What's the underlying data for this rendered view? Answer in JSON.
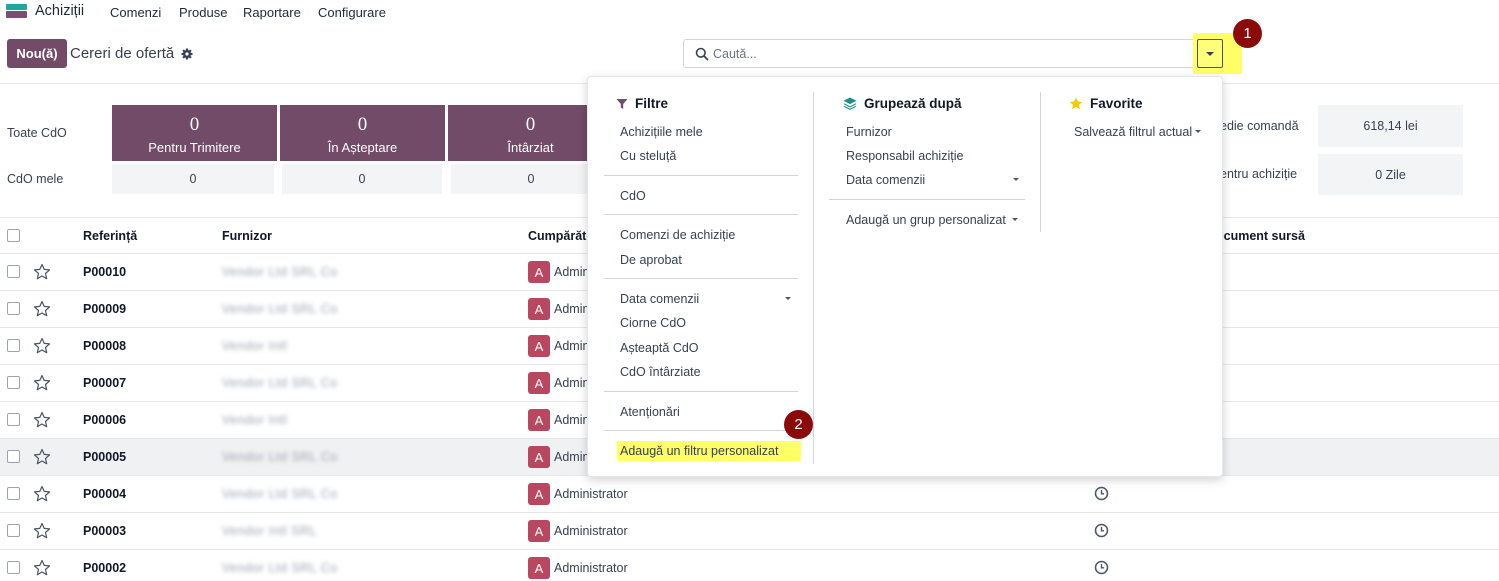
{
  "nav": {
    "app_name": "Achiziții",
    "menu": [
      "Comenzi",
      "Produse",
      "Raportare",
      "Configurare"
    ]
  },
  "control": {
    "new_button": "Nou(ă)",
    "title": "Cereri de ofertă",
    "search_placeholder": "Caută...",
    "badge1": "1",
    "badge2": "2"
  },
  "dashboard": {
    "row_labels": [
      "Toate CdO",
      "CdO mele"
    ],
    "tiles": [
      {
        "value": "0",
        "label": "Pentru Trimitere",
        "mine": "0"
      },
      {
        "value": "0",
        "label": "În Așteptare",
        "mine": "0"
      },
      {
        "value": "0",
        "label": "Întârziat",
        "mine": "0"
      }
    ],
    "right": [
      {
        "label": "edie comandă",
        "value": "618,14 lei"
      },
      {
        "label": "entru achiziție",
        "value": "0 Zile"
      }
    ]
  },
  "table": {
    "headers": {
      "reference": "Referință",
      "vendor": "Furnizor",
      "buyer": "Cumpărăto",
      "source": "ocument sursă"
    },
    "rows": [
      {
        "ref": "P00010",
        "vendor": "Vendor Ltd SRL Co",
        "avatar": "A",
        "buyer": "Admin"
      },
      {
        "ref": "P00009",
        "vendor": "Vendor Ltd SRL Co",
        "avatar": "A",
        "buyer": "Admin"
      },
      {
        "ref": "P00008",
        "vendor": "Vendor Intl",
        "avatar": "A",
        "buyer": "Admin"
      },
      {
        "ref": "P00007",
        "vendor": "Vendor Ltd SRL Co",
        "avatar": "A",
        "buyer": "Admin"
      },
      {
        "ref": "P00006",
        "vendor": "Vendor Intl",
        "avatar": "A",
        "buyer": "Admin"
      },
      {
        "ref": "P00005",
        "vendor": "Vendor Ltd SRL Co",
        "avatar": "A",
        "buyer": "Admin"
      },
      {
        "ref": "P00004",
        "vendor": "Vendor Ltd SRL Co",
        "avatar": "A",
        "buyer": "Administrator"
      },
      {
        "ref": "P00003",
        "vendor": "Vendor Intl SRL",
        "avatar": "A",
        "buyer": "Administrator"
      },
      {
        "ref": "P00002",
        "vendor": "Vendor Ltd SRL Co",
        "avatar": "A",
        "buyer": "Administrator"
      }
    ]
  },
  "dropdown": {
    "filters": {
      "title": "Filtre",
      "group1": [
        "Achizițiile mele",
        "Cu steluță"
      ],
      "group2": [
        "CdO"
      ],
      "group3": [
        "Comenzi de achiziție",
        "De aprobat"
      ],
      "group4": [
        "Data comenzii",
        "Ciorne CdO",
        "Așteaptă CdO",
        "CdO întârziate"
      ],
      "group5": [
        "Atenționări"
      ],
      "custom": "Adaugă un filtru personalizat"
    },
    "groupby": {
      "title": "Grupează după",
      "items": [
        "Furnizor",
        "Responsabil achiziție",
        "Data comenzii"
      ],
      "custom": "Adaugă un grup personalizat"
    },
    "favorites": {
      "title": "Favorite",
      "save": "Salvează filtrul actual"
    }
  },
  "colors": {
    "primary": "#714b67",
    "avatar": "#b8475f",
    "highlight": "#ffff66",
    "badge": "#8b0a0a"
  }
}
